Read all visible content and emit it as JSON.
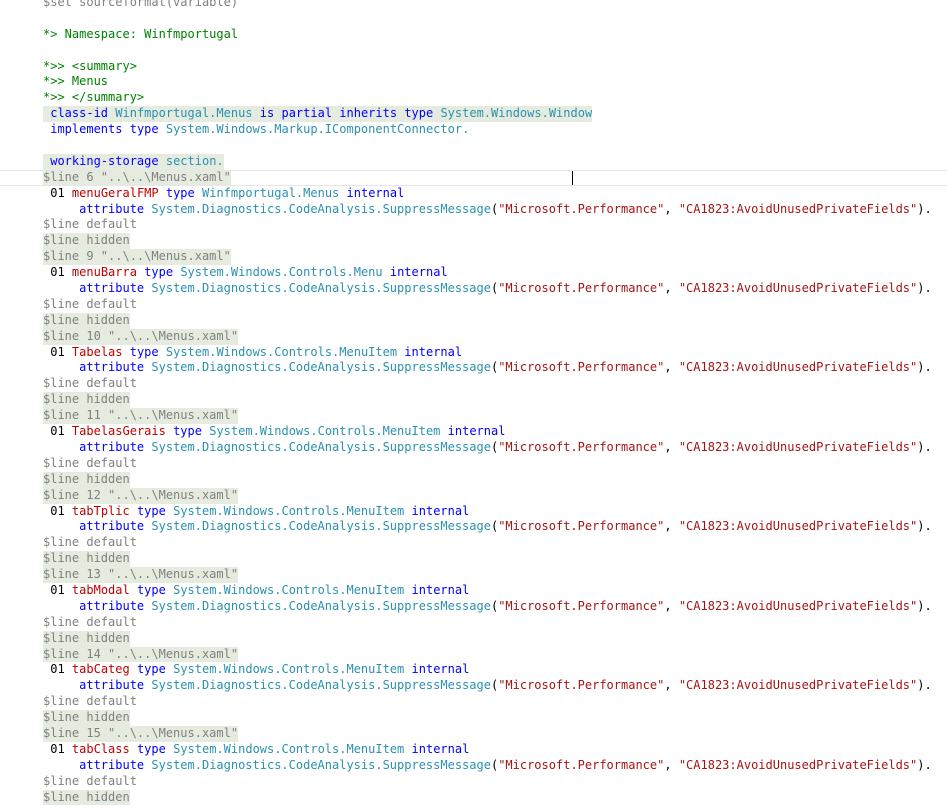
{
  "editor": {
    "lines": [
      {
        "text": "$set sourceformat(variable)"
      },
      {
        "text": ""
      },
      {
        "text": "*> Namespace: Winfmportugal"
      },
      {
        "text": ""
      },
      {
        "text": "*>> <summary>"
      },
      {
        "text": "*>> Menus"
      },
      {
        "text": "*>> </summary>"
      },
      {
        "text": " class-id Winfmportugal.Menus is partial inherits type System.Windows.Window"
      },
      {
        "text": " implements type System.Windows.Markup.IComponentConnector."
      },
      {
        "text": ""
      },
      {
        "text": " working-storage section."
      },
      {
        "text": "$line 6 \"..\\..\\Menus.xaml\""
      },
      {
        "text": " 01 menuGeralFMP type Winfmportugal.Menus internal"
      },
      {
        "text": "     attribute System.Diagnostics.CodeAnalysis.SuppressMessage(\"Microsoft.Performance\", \"CA1823:AvoidUnusedPrivateFields\")."
      },
      {
        "text": "$line default"
      },
      {
        "text": "$line hidden"
      },
      {
        "text": "$line 9 \"..\\..\\Menus.xaml\""
      },
      {
        "text": " 01 menuBarra type System.Windows.Controls.Menu internal"
      },
      {
        "text": "     attribute System.Diagnostics.CodeAnalysis.SuppressMessage(\"Microsoft.Performance\", \"CA1823:AvoidUnusedPrivateFields\")."
      },
      {
        "text": "$line default"
      },
      {
        "text": "$line hidden"
      },
      {
        "text": "$line 10 \"..\\..\\Menus.xaml\""
      },
      {
        "text": " 01 Tabelas type System.Windows.Controls.MenuItem internal"
      },
      {
        "text": "     attribute System.Diagnostics.CodeAnalysis.SuppressMessage(\"Microsoft.Performance\", \"CA1823:AvoidUnusedPrivateFields\")."
      },
      {
        "text": "$line default"
      },
      {
        "text": "$line hidden"
      },
      {
        "text": "$line 11 \"..\\..\\Menus.xaml\""
      },
      {
        "text": " 01 TabelasGerais type System.Windows.Controls.MenuItem internal"
      },
      {
        "text": "     attribute System.Diagnostics.CodeAnalysis.SuppressMessage(\"Microsoft.Performance\", \"CA1823:AvoidUnusedPrivateFields\")."
      },
      {
        "text": "$line default"
      },
      {
        "text": "$line hidden"
      },
      {
        "text": "$line 12 \"..\\..\\Menus.xaml\""
      },
      {
        "text": " 01 tabTplic type System.Windows.Controls.MenuItem internal"
      },
      {
        "text": "     attribute System.Diagnostics.CodeAnalysis.SuppressMessage(\"Microsoft.Performance\", \"CA1823:AvoidUnusedPrivateFields\")."
      },
      {
        "text": "$line default"
      },
      {
        "text": "$line hidden"
      },
      {
        "text": "$line 13 \"..\\..\\Menus.xaml\""
      },
      {
        "text": " 01 tabModal type System.Windows.Controls.MenuItem internal"
      },
      {
        "text": "     attribute System.Diagnostics.CodeAnalysis.SuppressMessage(\"Microsoft.Performance\", \"CA1823:AvoidUnusedPrivateFields\")."
      },
      {
        "text": "$line default"
      },
      {
        "text": "$line hidden"
      },
      {
        "text": "$line 14 \"..\\..\\Menus.xaml\""
      },
      {
        "text": " 01 tabCateg type System.Windows.Controls.MenuItem internal"
      },
      {
        "text": "     attribute System.Diagnostics.CodeAnalysis.SuppressMessage(\"Microsoft.Performance\", \"CA1823:AvoidUnusedPrivateFields\")."
      },
      {
        "text": "$line default"
      },
      {
        "text": "$line hidden"
      },
      {
        "text": "$line 15 \"..\\..\\Menus.xaml\""
      },
      {
        "text": " 01 tabClass type System.Windows.Controls.MenuItem internal"
      },
      {
        "text": "     attribute System.Diagnostics.CodeAnalysis.SuppressMessage(\"Microsoft.Performance\", \"CA1823:AvoidUnusedPrivateFields\")."
      },
      {
        "text": "$line default"
      },
      {
        "text": "$line hidden"
      }
    ]
  },
  "colors": {
    "keyword": "#0000ff",
    "type": "#2b91af",
    "string": "#a31515",
    "field_name": "#c00000",
    "directive": "#808080",
    "comment": "#008000",
    "highlight": "#e5ecdf",
    "squiggle": "#e03030"
  }
}
